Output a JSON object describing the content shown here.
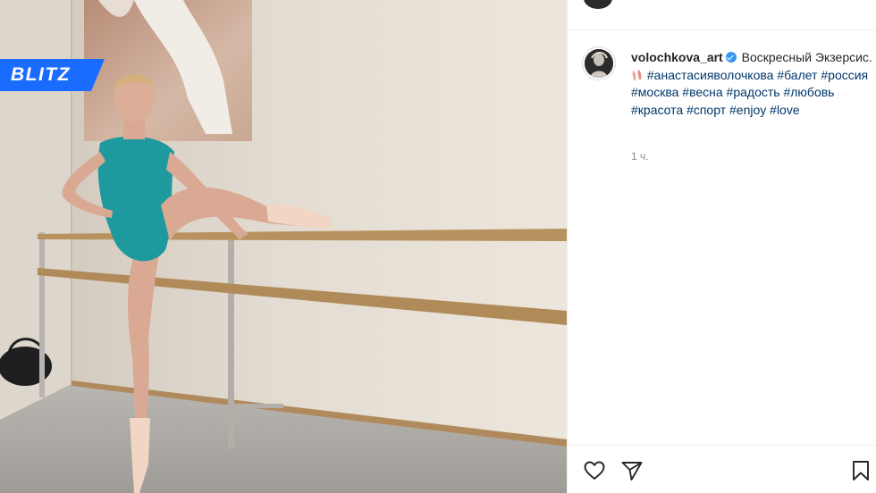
{
  "watermark": {
    "text": "BLITZ"
  },
  "post": {
    "username": "volochkova_art",
    "caption_text": "Воскресный Экзерсис.",
    "hashtags": [
      "#анастасияволочкова",
      "#балет",
      "#россия",
      "#москва",
      "#весна",
      "#радость",
      "#любовь",
      "#красота",
      "#спорт",
      "#enjoy",
      "#love"
    ],
    "time": "1 ч."
  },
  "icons": {
    "verified": "verified-badge-icon",
    "caption_emoji": "ballet-shoes-emoji",
    "like": "heart-icon",
    "share": "paper-plane-icon",
    "save": "bookmark-icon"
  },
  "colors": {
    "hashtag": "#00376b",
    "verified": "#3897f0",
    "watermark": "#1a6cff",
    "secondary_text": "#8e8e8e"
  }
}
